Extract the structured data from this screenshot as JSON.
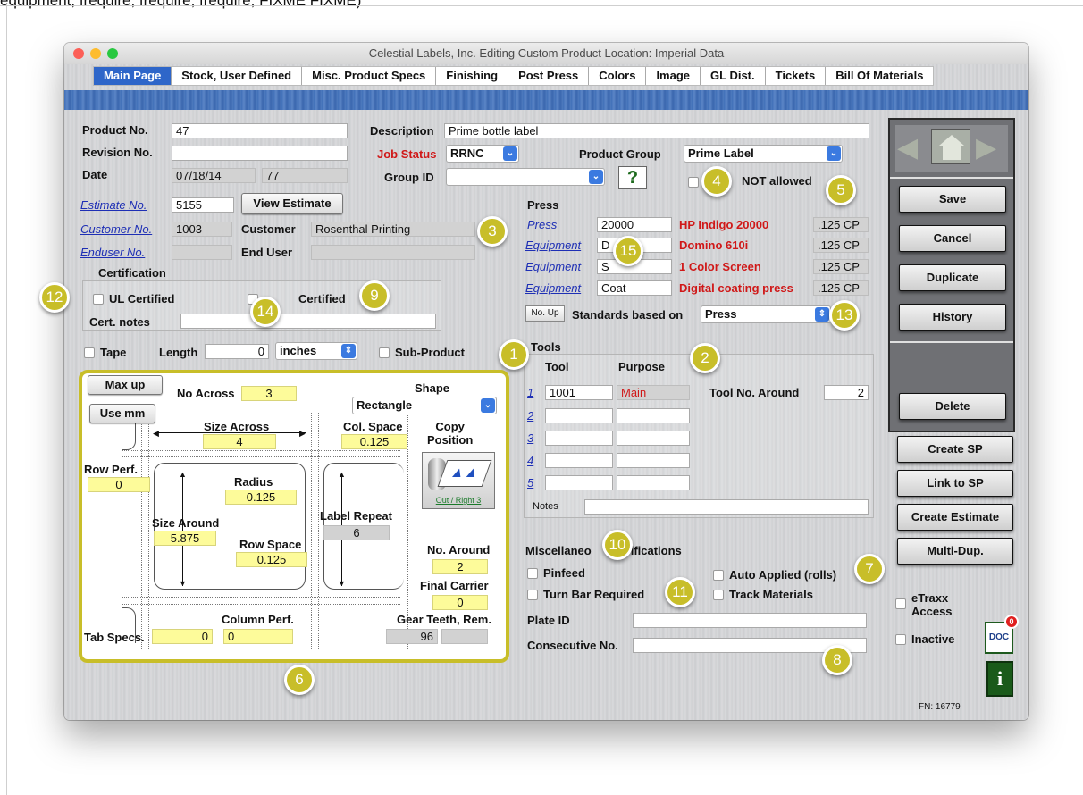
{
  "top_caption": "equipment, frequire, frequire, frequire, FIXME FIXME)",
  "window": {
    "title": "Celestial Labels, Inc.   Editing Custom Product   Location: Imperial Data",
    "tabs": [
      "Main Page",
      "Stock, User Defined",
      "Misc. Product Specs",
      "Finishing",
      "Post Press",
      "Colors",
      "Image",
      "GL Dist.",
      "Tickets",
      "Bill Of Materials"
    ]
  },
  "product": {
    "product_no_label": "Product No.",
    "product_no": "47",
    "revision_label": "Revision No.",
    "revision": "",
    "date_label": "Date",
    "date": "07/18/14",
    "date_extra": "77",
    "estimate_label": "Estimate No.",
    "estimate": "5155",
    "view_estimate": "View Estimate",
    "customer_no_label": "Customer No.",
    "customer_no": "1003",
    "customer_label": "Customer",
    "customer": "Rosenthal Printing",
    "enduser_no_label": "Enduser No.",
    "enduser_no": "",
    "end_user_label": "End User",
    "end_user": "",
    "description_label": "Description",
    "description": "Prime bottle label",
    "job_status_label": "Job Status",
    "job_status": "RRNC",
    "product_group_label": "Product Group",
    "product_group": "Prime Label",
    "group_id_label": "Group ID",
    "group_id": "",
    "help": "?",
    "not_allowed_label": "NOT allowed"
  },
  "certification": {
    "title": "Certification",
    "ul_label": "UL Certified",
    "other_label": "Certified",
    "notes_label": "Cert. notes",
    "notes": ""
  },
  "tape": {
    "tape_label": "Tape",
    "length_label": "Length",
    "length": "0",
    "unit": "inches",
    "subproduct_label": "Sub-Product"
  },
  "diagram": {
    "max_up": "Max up",
    "use_mm": "Use mm",
    "no_across_label": "No Across",
    "no_across": "3",
    "shape_label": "Shape",
    "shape": "Rectangle",
    "size_across_label": "Size Across",
    "size_across": "4",
    "col_space_label": "Col. Space",
    "col_space": "0.125",
    "copy_position_label": "Copy\nPosition",
    "copy_position_caption": "Out / Right 3",
    "row_perf_label": "Row Perf.",
    "row_perf": "0",
    "radius_label": "Radius",
    "radius": "0.125",
    "size_around_label": "Size Around",
    "size_around": "5.875",
    "label_repeat_label": "Label Repeat",
    "label_repeat": "6",
    "row_space_label": "Row Space",
    "row_space": "0.125",
    "no_around_label": "No. Around",
    "no_around": "2",
    "final_carrier_label": "Final Carrier",
    "final_carrier": "0",
    "column_perf_label": "Column Perf.",
    "column_perf": "0",
    "tab_specs_label": "Tab Specs.",
    "tab_specs": "0",
    "gear_teeth_label": "Gear Teeth, Rem.",
    "gear_teeth": "96",
    "gear_rem": ""
  },
  "press": {
    "title": "Press",
    "rows": [
      {
        "label": "Press",
        "code": "20000",
        "name": "HP Indigo 20000",
        "cp": ".125 CP"
      },
      {
        "label": "Equipment",
        "code": "D",
        "name": "Domino 610i",
        "cp": ".125 CP"
      },
      {
        "label": "Equipment",
        "code": "S",
        "name": "1 Color Screen",
        "cp": ".125 CP"
      },
      {
        "label": "Equipment",
        "code": "Coat",
        "name": "Digital coating press",
        "cp": ".125 CP"
      }
    ],
    "no_up": "No. Up",
    "standards_label": "Standards based on",
    "standards": "Press"
  },
  "tools": {
    "title": "Tools",
    "col_tool": "Tool",
    "col_purpose": "Purpose",
    "rows": [
      {
        "n": "1",
        "tool": "1001",
        "purpose": "Main"
      },
      {
        "n": "2",
        "tool": "",
        "purpose": ""
      },
      {
        "n": "3",
        "tool": "",
        "purpose": ""
      },
      {
        "n": "4",
        "tool": "",
        "purpose": ""
      },
      {
        "n": "5",
        "tool": "",
        "purpose": ""
      }
    ],
    "tool_no_around_label": "Tool No. Around",
    "tool_no_around": "2",
    "notes_label": "Notes",
    "notes": ""
  },
  "misc": {
    "title_left": "Miscellaneo",
    "title_right": "ifications",
    "pinfeed": "Pinfeed",
    "turn_bar": "Turn Bar Required",
    "auto_applied": "Auto Applied (rolls)",
    "track_materials": "Track Materials",
    "plate_id_label": "Plate ID",
    "plate_id": "",
    "consecutive_label": "Consecutive No.",
    "consecutive": ""
  },
  "sidebar": {
    "save": "Save",
    "cancel": "Cancel",
    "duplicate": "Duplicate",
    "history": "History",
    "delete": "Delete",
    "create_sp": "Create SP",
    "link_sp": "Link to SP",
    "create_estimate": "Create Estimate",
    "multi_dup": "Multi-Dup.",
    "etraxx": "eTraxx\nAccess",
    "inactive": "Inactive",
    "doc_label": "DOC",
    "doc_badge": "0",
    "info": "i",
    "fn": "FN: 16779"
  },
  "callouts": [
    "1",
    "2",
    "3",
    "4",
    "5",
    "6",
    "7",
    "8",
    "9",
    "10",
    "11",
    "12",
    "13",
    "14",
    "15"
  ],
  "colors": {
    "accent": "#2e66c9",
    "callout": "#c8be29",
    "highlight": "#fdfb9a",
    "red_text": "#d01818"
  }
}
